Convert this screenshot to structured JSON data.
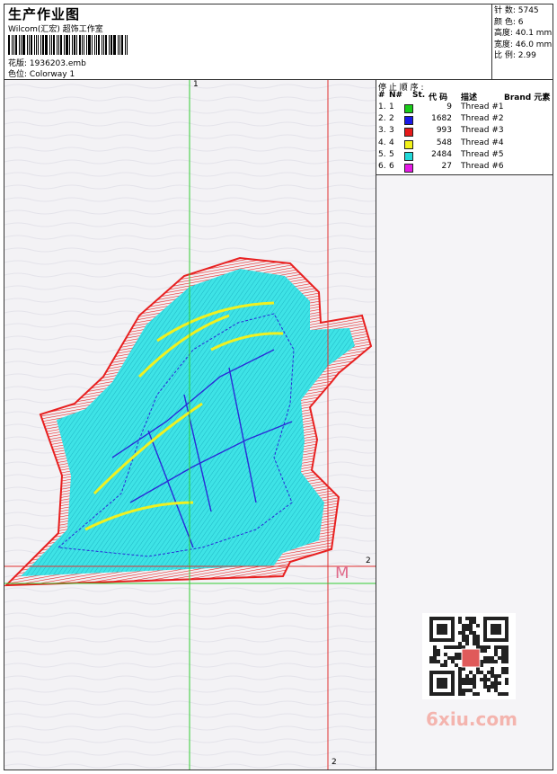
{
  "header": {
    "title": "生产作业图",
    "subtitle": "Wilcom(汇宏) 超饰工作室",
    "design_label": "花版:",
    "design_value": "1936203.emb",
    "colorway_label": "色位:",
    "colorway_value": "Colorway 1"
  },
  "stats": {
    "stitches": "针 数: 5745",
    "colors": "颜 色: 6",
    "height": "高度: 40.1 mm",
    "width": "宽度: 46.0 mm",
    "ratio": "比 例: 2.99"
  },
  "thread_table": {
    "caption": "停 止 顺 序 :",
    "headers": {
      "idx": "#",
      "no": "N#",
      "st": "St.",
      "code": "代 码",
      "desc": "描述",
      "brand": "Brand 元素"
    },
    "rows": [
      {
        "idx": "1.",
        "no": "1",
        "color": "#19cc19",
        "st": "9",
        "desc": "Thread #1"
      },
      {
        "idx": "2.",
        "no": "2",
        "color": "#1a1ae6",
        "st": "1682",
        "desc": "Thread #2"
      },
      {
        "idx": "3.",
        "no": "3",
        "color": "#e61a1a",
        "st": "993",
        "desc": "Thread #3"
      },
      {
        "idx": "4.",
        "no": "4",
        "color": "#f2f21a",
        "st": "548",
        "desc": "Thread #4"
      },
      {
        "idx": "5.",
        "no": "5",
        "color": "#22d9d9",
        "st": "2484",
        "desc": "Thread #5"
      },
      {
        "idx": "6.",
        "no": "6",
        "color": "#e61ae6",
        "st": "27",
        "desc": "Thread #6"
      }
    ]
  },
  "canvas": {
    "axis_top": "1",
    "axis_right": "2",
    "axis_bottom": "2",
    "marker": "M"
  },
  "watermark": "6xiu.com",
  "colors": {
    "guide_green": "#33cc33",
    "guide_red": "#e03030",
    "outline_red": "#e82020",
    "fill_cyan": "#33e0e0",
    "fill_blue": "#2a2ad8",
    "fill_yellow": "#f0f020"
  }
}
